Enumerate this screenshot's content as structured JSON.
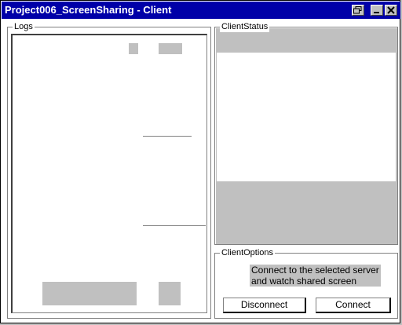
{
  "window": {
    "title": "Project006_ScreenSharing - Client"
  },
  "logs": {
    "label": "Logs"
  },
  "client_status": {
    "label": "ClientStatus"
  },
  "client_options": {
    "label": "ClientOptions",
    "description_line1": "Connect to the selected server",
    "description_line2": "and watch shared screen",
    "disconnect_label": "Disconnect",
    "connect_label": "Connect"
  },
  "icons": {
    "restore": "restore-icon",
    "minimize": "minimize-icon",
    "close": "close-icon"
  },
  "colors": {
    "titlebar": "#0000a8",
    "panel": "#c0c0c0"
  }
}
